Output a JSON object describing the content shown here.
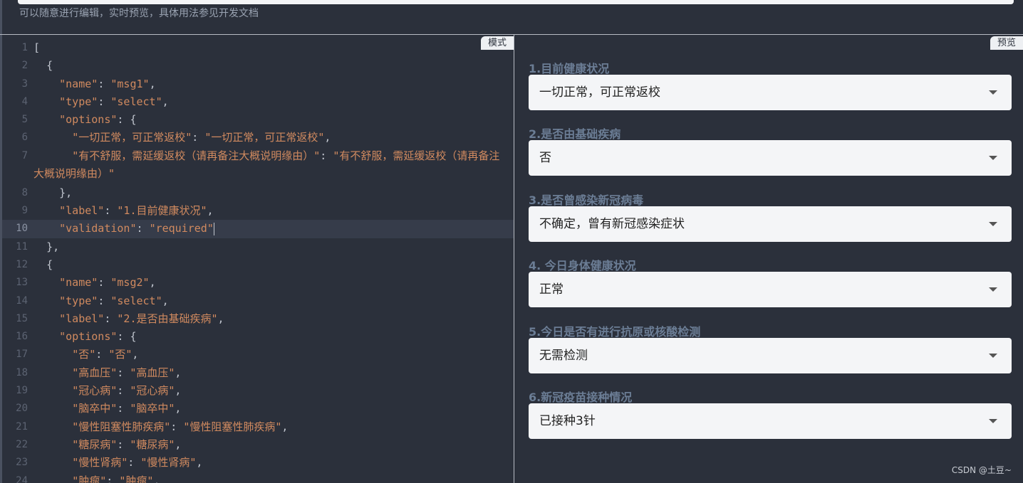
{
  "header": {
    "hint": "可以随意进行编辑，实时预览，具体用法参见开发文档"
  },
  "editor": {
    "tag": "模式",
    "lines": [
      {
        "n": "1",
        "text": "["
      },
      {
        "n": "2",
        "text": "  {"
      },
      {
        "n": "3",
        "text": "    \"name\": \"msg1\","
      },
      {
        "n": "4",
        "text": "    \"type\": \"select\","
      },
      {
        "n": "5",
        "text": "    \"options\": {"
      },
      {
        "n": "6",
        "text": "      \"一切正常，可正常返校\": \"一切正常，可正常返校\","
      },
      {
        "n": "7",
        "text": "      \"有不舒服，需延缓返校（请再备注大概说明缘由）\": \"有不舒服，需延缓返校（请再备注大概说明缘由）\""
      },
      {
        "n": "8",
        "text": "    },"
      },
      {
        "n": "9",
        "text": "    \"label\": \"1.目前健康状况\","
      },
      {
        "n": "10",
        "text": "    \"validation\": \"required\""
      },
      {
        "n": "11",
        "text": "  },"
      },
      {
        "n": "12",
        "text": "  {"
      },
      {
        "n": "13",
        "text": "    \"name\": \"msg2\","
      },
      {
        "n": "14",
        "text": "    \"type\": \"select\","
      },
      {
        "n": "15",
        "text": "    \"label\": \"2.是否由基础疾病\","
      },
      {
        "n": "16",
        "text": "    \"options\": {"
      },
      {
        "n": "17",
        "text": "      \"否\": \"否\","
      },
      {
        "n": "18",
        "text": "      \"高血压\": \"高血压\","
      },
      {
        "n": "19",
        "text": "      \"冠心病\": \"冠心病\","
      },
      {
        "n": "20",
        "text": "      \"脑卒中\": \"脑卒中\","
      },
      {
        "n": "21",
        "text": "      \"慢性阻塞性肺疾病\": \"慢性阻塞性肺疾病\","
      },
      {
        "n": "22",
        "text": "      \"糖尿病\": \"糖尿病\","
      },
      {
        "n": "23",
        "text": "      \"慢性肾病\": \"慢性肾病\","
      },
      {
        "n": "24",
        "text": "      \"肿瘤\": \"肿瘤\","
      }
    ]
  },
  "preview": {
    "tag": "预览",
    "fields": [
      {
        "label": "1.目前健康状况",
        "value": "一切正常，可正常返校"
      },
      {
        "label": "2.是否由基础疾病",
        "value": "否"
      },
      {
        "label": "3.是否曾感染新冠病毒",
        "value": "不确定，曾有新冠感染症状"
      },
      {
        "label": "4. 今日身体健康状况",
        "value": "正常"
      },
      {
        "label": "5.今日是否有进行抗原或核酸检测",
        "value": "无需检测"
      },
      {
        "label": "6.新冠疫苗接种情况",
        "value": "已接种3针"
      }
    ]
  },
  "watermark": "CSDN @土豆~"
}
